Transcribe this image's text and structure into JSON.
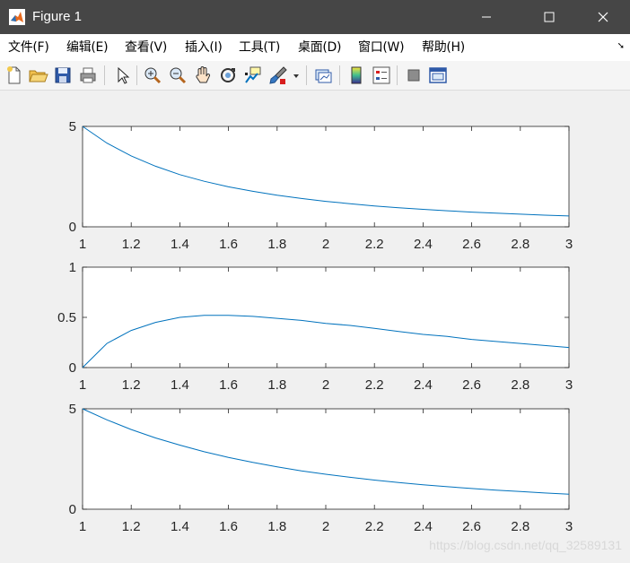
{
  "window": {
    "title": "Figure 1"
  },
  "menu": [
    "文件(F)",
    "编辑(E)",
    "查看(V)",
    "插入(I)",
    "工具(T)",
    "桌面(D)",
    "窗口(W)",
    "帮助(H)"
  ],
  "toolbar": [
    "new-file-icon",
    "open-folder-icon",
    "save-icon",
    "print-icon",
    "pointer-icon",
    "zoom-in-icon",
    "zoom-out-icon",
    "pan-hand-icon",
    "rotate-3d-icon",
    "data-cursor-icon",
    "brush-icon",
    "link-plot-icon",
    "colorbar-icon",
    "legend-icon",
    "hide-plot-tools-icon",
    "show-plot-tools-icon"
  ],
  "watermark": "https://blog.csdn.net/qq_32589131",
  "colors": {
    "line": "#0072bd",
    "axis": "#262626",
    "titlebar": "#464646"
  },
  "chart_data": [
    {
      "type": "line",
      "x": [
        1.0,
        1.1,
        1.2,
        1.3,
        1.4,
        1.5,
        1.6,
        1.7,
        1.8,
        1.9,
        2.0,
        2.1,
        2.2,
        2.3,
        2.4,
        2.5,
        2.6,
        2.7,
        2.8,
        2.9,
        3.0
      ],
      "values": [
        5.0,
        4.17,
        3.53,
        3.02,
        2.6,
        2.27,
        1.99,
        1.77,
        1.57,
        1.41,
        1.27,
        1.15,
        1.04,
        0.95,
        0.87,
        0.8,
        0.73,
        0.68,
        0.63,
        0.58,
        0.54
      ],
      "xlim": [
        1,
        3
      ],
      "ylim": [
        0,
        5
      ],
      "xticks": [
        "1",
        "1.2",
        "1.4",
        "1.6",
        "1.8",
        "2",
        "2.2",
        "2.4",
        "2.6",
        "2.8",
        "3"
      ],
      "yticks": [
        "0",
        "5"
      ],
      "grid": false
    },
    {
      "type": "line",
      "x": [
        1.0,
        1.1,
        1.2,
        1.3,
        1.4,
        1.5,
        1.6,
        1.7,
        1.8,
        1.9,
        2.0,
        2.1,
        2.2,
        2.3,
        2.4,
        2.5,
        2.6,
        2.7,
        2.8,
        2.9,
        3.0
      ],
      "values": [
        0.0,
        0.24,
        0.37,
        0.45,
        0.5,
        0.52,
        0.52,
        0.51,
        0.49,
        0.47,
        0.44,
        0.42,
        0.39,
        0.36,
        0.33,
        0.31,
        0.28,
        0.26,
        0.24,
        0.22,
        0.2
      ],
      "xlim": [
        1,
        3
      ],
      "ylim": [
        0,
        1
      ],
      "xticks": [
        "1",
        "1.2",
        "1.4",
        "1.6",
        "1.8",
        "2",
        "2.2",
        "2.4",
        "2.6",
        "2.8",
        "3"
      ],
      "yticks": [
        "0",
        "0.5",
        "1"
      ],
      "grid": false
    },
    {
      "type": "line",
      "x": [
        1.0,
        1.1,
        1.2,
        1.3,
        1.4,
        1.5,
        1.6,
        1.7,
        1.8,
        1.9,
        2.0,
        2.1,
        2.2,
        2.3,
        2.4,
        2.5,
        2.6,
        2.7,
        2.8,
        2.9,
        3.0
      ],
      "values": [
        5.0,
        4.45,
        3.97,
        3.55,
        3.19,
        2.86,
        2.58,
        2.33,
        2.11,
        1.91,
        1.74,
        1.59,
        1.45,
        1.33,
        1.22,
        1.12,
        1.03,
        0.95,
        0.88,
        0.81,
        0.75
      ],
      "xlim": [
        1,
        3
      ],
      "ylim": [
        0,
        5
      ],
      "xticks": [
        "1",
        "1.2",
        "1.4",
        "1.6",
        "1.8",
        "2",
        "2.2",
        "2.4",
        "2.6",
        "2.8",
        "3"
      ],
      "yticks": [
        "0",
        "5"
      ],
      "grid": false
    }
  ]
}
